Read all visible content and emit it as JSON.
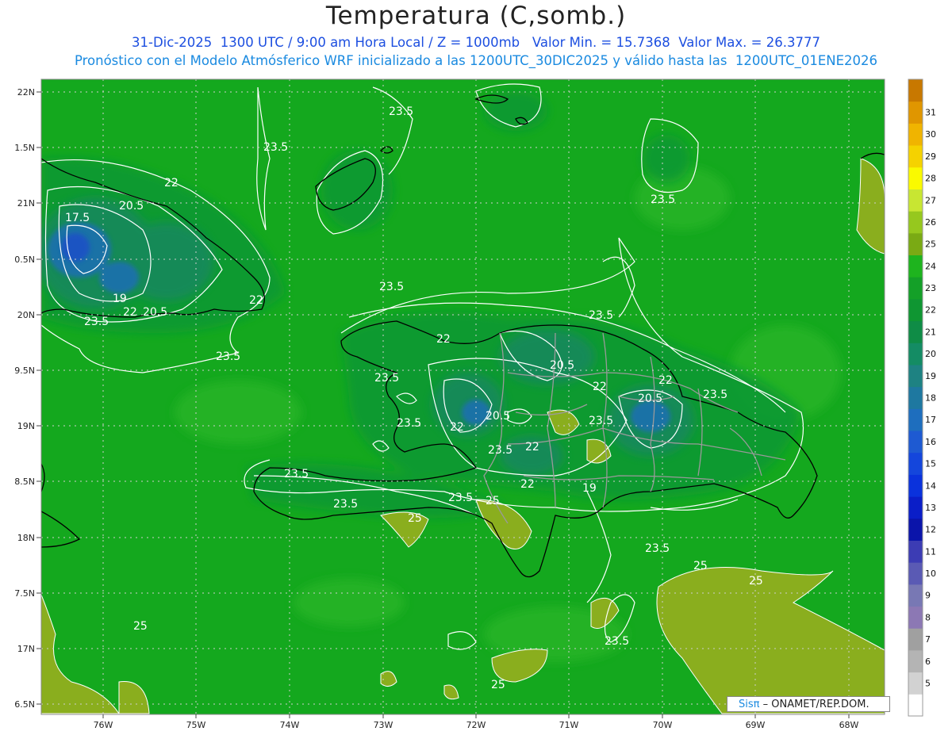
{
  "header": {
    "title": "Temperatura (C,somb.)",
    "line1": "31-Dic-2025  1300 UTC / 9:00 am Hora Local / Z = 1000mb   Valor Min. = 15.7368  Valor Max. = 26.3777",
    "line2": "Pronóstico con el Modelo Atmósferico WRF inicializado a las 1200UTC_30DIC2025 y válido hasta las  1200UTC_01ENE2026"
  },
  "axes": {
    "lat_labels": [
      "22N",
      "1.5N",
      "21N",
      "0.5N",
      "20N",
      "9.5N",
      "19N",
      "8.5N",
      "18N",
      "7.5N",
      "17N",
      "6.5N"
    ],
    "lon_labels": [
      "76W",
      "75W",
      "74W",
      "73W",
      "72W",
      "71W",
      "70W",
      "69W",
      "68W"
    ]
  },
  "contour_labels": [
    "23.5",
    "23.5",
    "22",
    "20.5",
    "17.5",
    "19",
    "22",
    "20.5",
    "22",
    "23.5",
    "23.5",
    "23.5",
    "23.5",
    "22",
    "23.5",
    "23.5",
    "22",
    "20.5",
    "22",
    "20.5",
    "22",
    "23.5",
    "20.5",
    "23.5",
    "22",
    "23.5",
    "22",
    "23.5",
    "23.5",
    "25",
    "23.5",
    "25",
    "23.5",
    "25",
    "25",
    "23.5",
    "25",
    "25"
  ],
  "colorbar": {
    "labels": [
      "31",
      "30",
      "29",
      "28",
      "27",
      "26",
      "25",
      "24",
      "23",
      "22",
      "21",
      "20",
      "19",
      "18",
      "17",
      "16",
      "15",
      "14",
      "13",
      "12",
      "11",
      "10",
      "9",
      "8",
      "7",
      "6",
      "5"
    ],
    "colors": [
      "#c87800",
      "#e09600",
      "#f0b400",
      "#f5d200",
      "#fafa00",
      "#c8e632",
      "#96c81e",
      "#7aaa14",
      "#1eb41e",
      "#14a028",
      "#0f9632",
      "#0f8c46",
      "#148c64",
      "#1e8282",
      "#1e78a0",
      "#1e6ebe",
      "#1e5ad2",
      "#1446dc",
      "#0a32dc",
      "#0a1ec8",
      "#0a14aa",
      "#3c3cb4",
      "#5a5ab4",
      "#7878b4",
      "#8c78b4",
      "#a0a0a0",
      "#b4b4b4",
      "#d2d2d2",
      "#ffffff"
    ]
  },
  "colors": {
    "base_green": "#14a81e",
    "light_green": "#2ab52a",
    "warm": "#8ab020",
    "cool": "#1e8c6e",
    "cold": "#1e64b4",
    "contour": "#ffffff",
    "coast": "#000000",
    "border": "#9a9a9a"
  },
  "credit": {
    "sis": "Sisπ",
    "rest": "– ONAMET/REP.DOM."
  }
}
